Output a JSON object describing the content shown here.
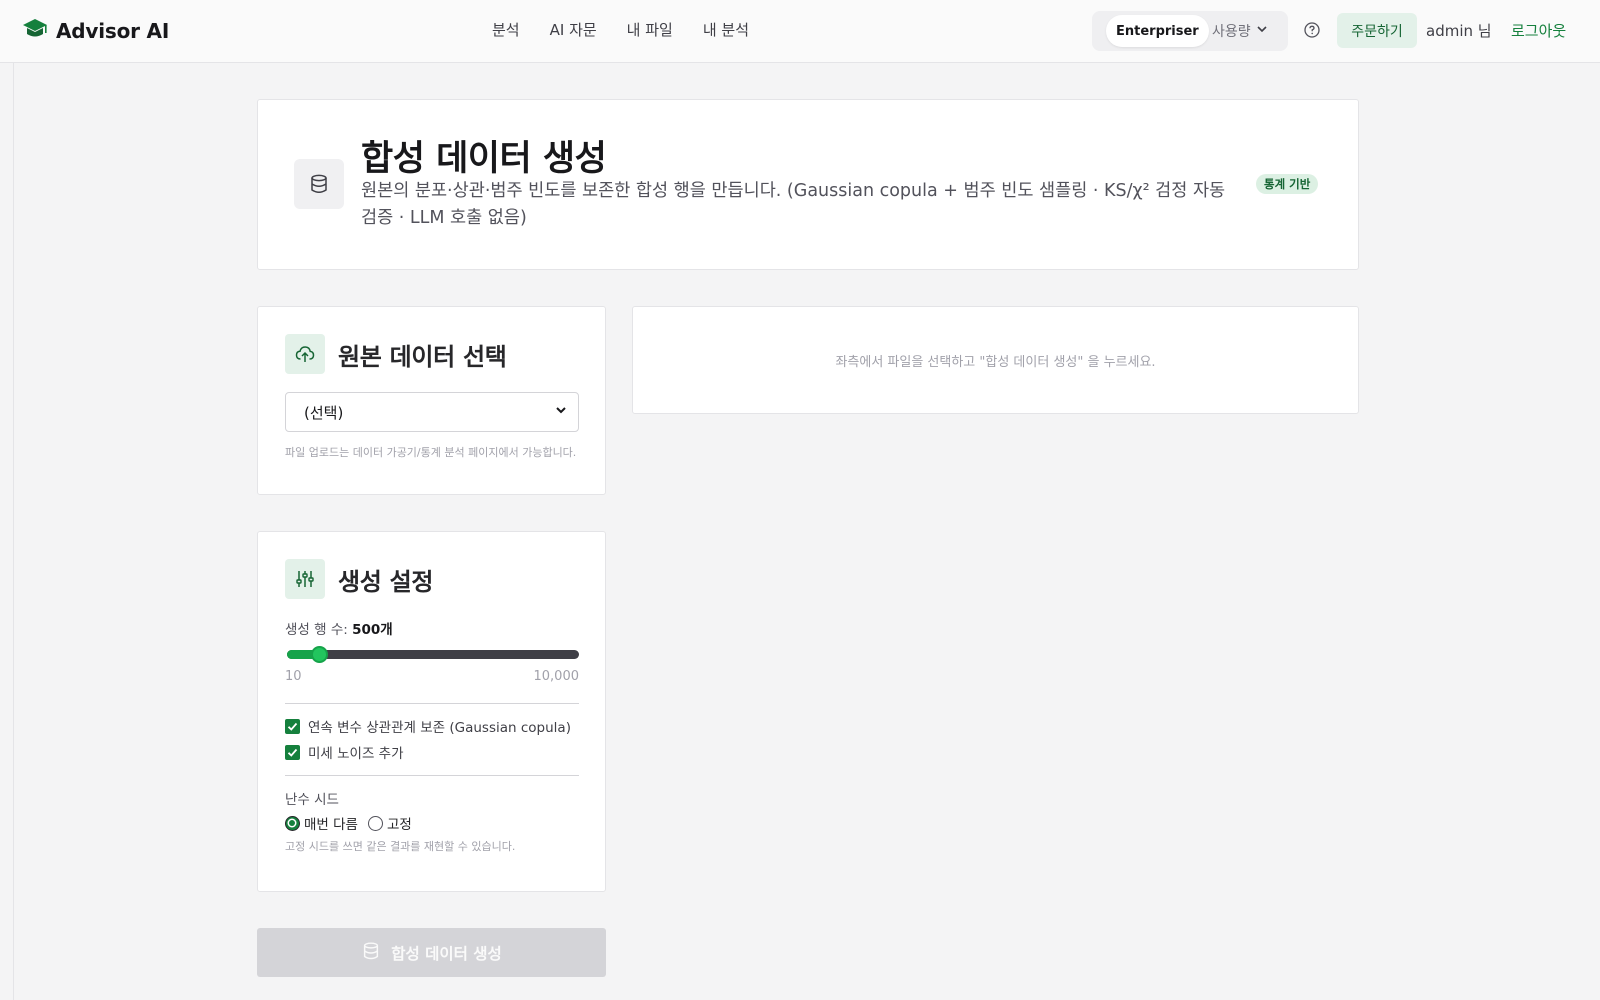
{
  "app": {
    "brand": "Advisor AI"
  },
  "nav": {
    "links": [
      "분석",
      "AI 자문",
      "내 파일",
      "내 분석"
    ],
    "plan": "Enterpriser",
    "usage_label": "사용량",
    "order_label": "주문하기",
    "user_label": "admin 님",
    "logout_label": "로그아웃"
  },
  "hero": {
    "title": "합성 데이터 생성",
    "description": "원본의 분포·상관·범주 빈도를 보존한 합성 행을 만듭니다. (Gaussian copula + 범주 빈도 샘플링 · KS/χ² 검정 자동 검증 · LLM 호출 없음)",
    "badge": "통계 기반"
  },
  "source": {
    "title": "원본 데이터 선택",
    "select_value": "(선택)",
    "hint": "파일 업로드는 데이터 가공기/통계 분석 페이지에서 가능합니다."
  },
  "settings": {
    "title": "생성 설정",
    "rows_label": "생성 행 수: ",
    "rows_value_text": "500개",
    "rows": {
      "value": 500,
      "min": 10,
      "max": 10000
    },
    "range_min_label": "10",
    "range_max_label": "10,000",
    "options": [
      {
        "label": "연속 변수 상관관계 보존 (Gaussian copula)",
        "checked": true
      },
      {
        "label": "미세 노이즈 추가",
        "checked": true
      }
    ],
    "seed_label": "난수 시드",
    "seed_options": [
      {
        "label": "매번 다름",
        "selected": true
      },
      {
        "label": "고정",
        "selected": false
      }
    ],
    "seed_hint": "고정 시드를 쓰면 같은 결과를 재현할 수 있습니다."
  },
  "generate_button": {
    "label": "합성 데이터 생성",
    "enabled": false
  },
  "result": {
    "placeholder": "좌측에서 파일을 선택하고 \"합성 데이터 생성\" 을 누르세요."
  },
  "colors": {
    "accent": "#15803d",
    "accent_soft": "#e3f1e9",
    "disabled": "#d4d4d8"
  }
}
